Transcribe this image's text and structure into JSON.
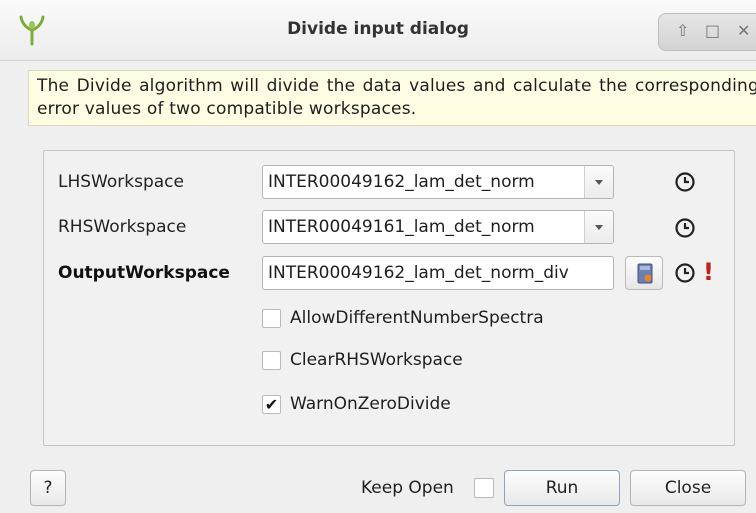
{
  "window": {
    "title": "Divide input dialog",
    "controls": {
      "shade": "⇧",
      "maximize": "□",
      "close": "✕"
    }
  },
  "info_text": "The Divide algorithm will divide the data values and calculate the corresponding error values of two compatible workspaces.",
  "properties": {
    "lhs": {
      "label": "LHSWorkspace",
      "value": "INTER00049162_lam_det_norm"
    },
    "rhs": {
      "label": "RHSWorkspace",
      "value": "INTER00049161_lam_det_norm"
    },
    "output": {
      "label": "OutputWorkspace",
      "value": "INTER00049162_lam_det_norm_div",
      "invalid_marker": "!"
    }
  },
  "checkboxes": [
    {
      "label": "AllowDifferentNumberSpectra",
      "checked": false,
      "mark": ""
    },
    {
      "label": "ClearRHSWorkspace",
      "checked": false,
      "mark": ""
    },
    {
      "label": "WarnOnZeroDivide",
      "checked": true,
      "mark": "✔"
    }
  ],
  "footer": {
    "help_label": "?",
    "keep_open_label": "Keep Open",
    "keep_open_checked": false,
    "run_label": "Run",
    "close_label": "Close"
  },
  "icons": [
    "mantid-app-icon",
    "history-clock-icon",
    "browse-workspace-icon",
    "dropdown-arrow-icon",
    "checkmark-icon"
  ],
  "colors": {
    "info_bg": "#fdfde3",
    "error_marker": "#c0201a",
    "app_icon": "#7cae3a"
  }
}
